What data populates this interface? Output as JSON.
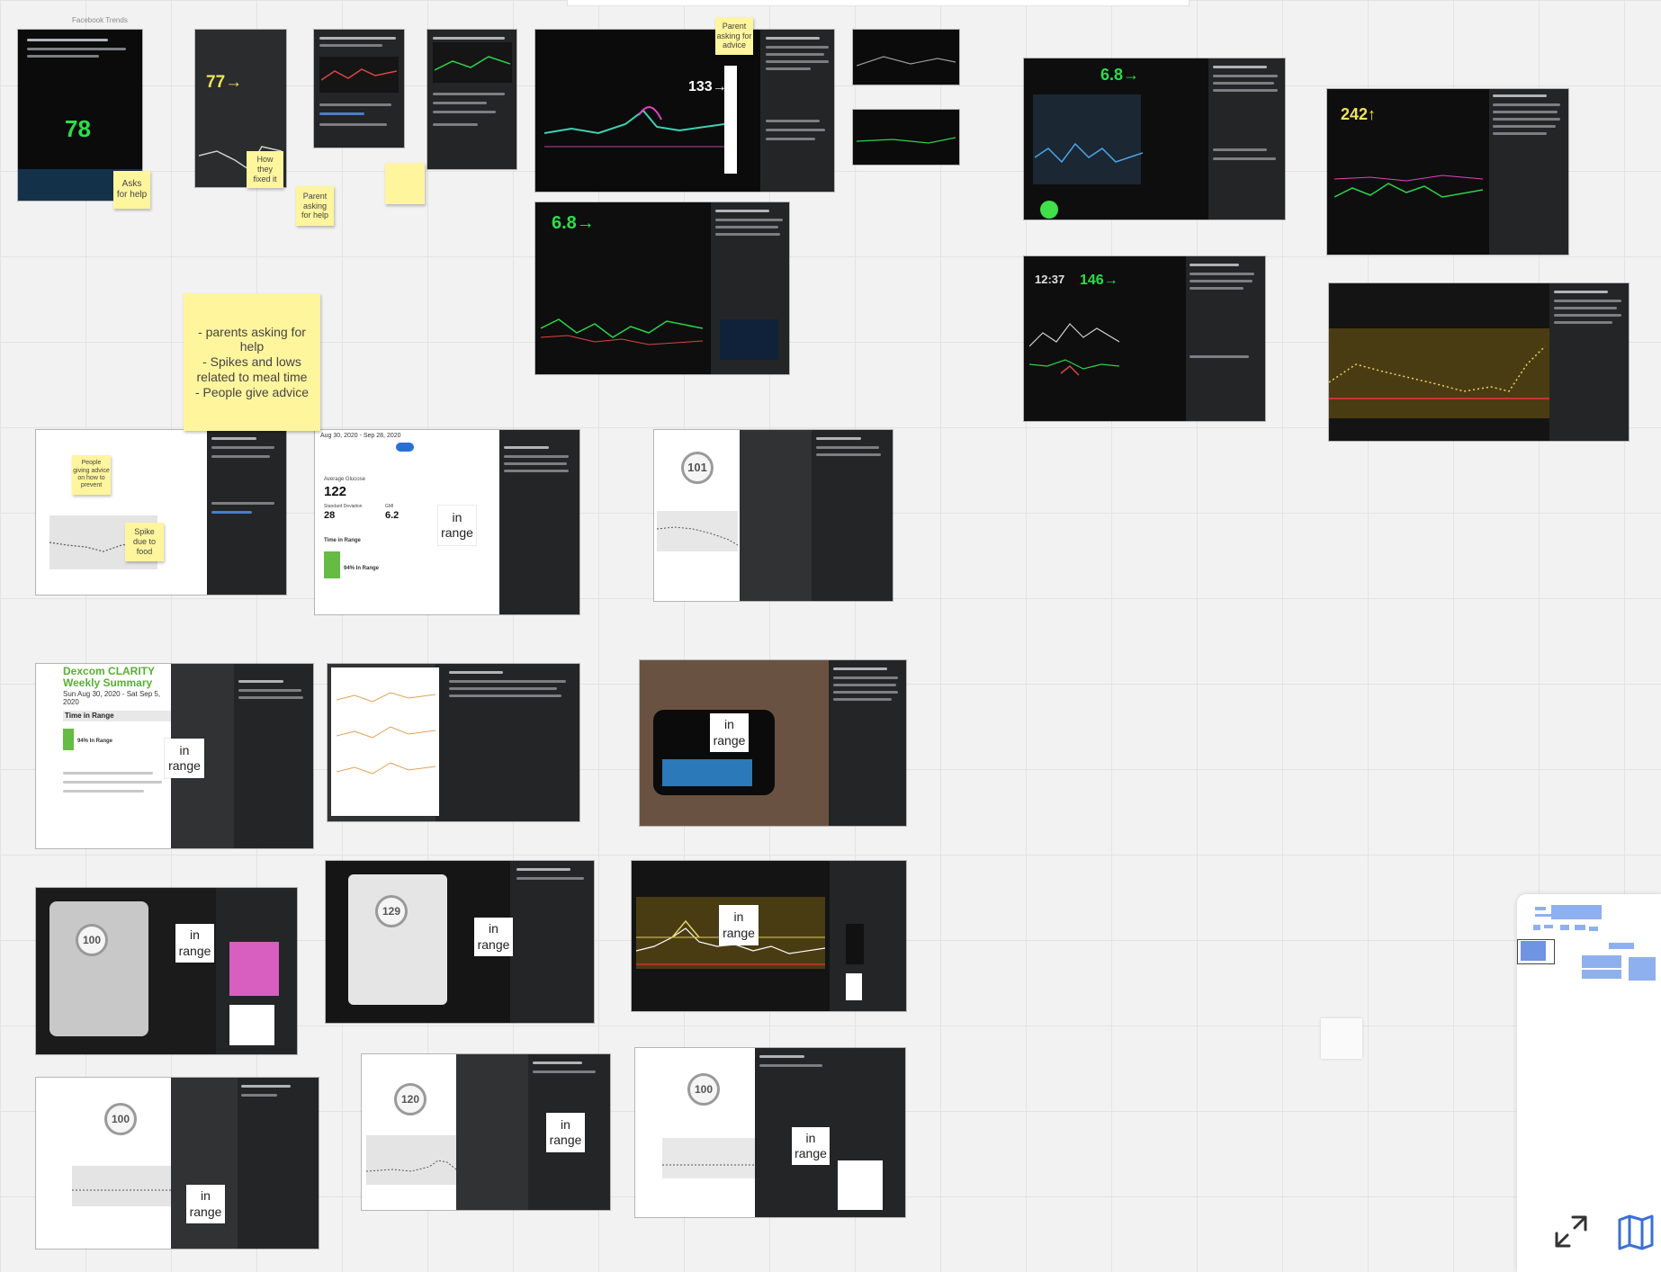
{
  "board": {
    "frame_title": "Facebook Trends"
  },
  "posts": [
    {
      "glucose": "78"
    },
    {
      "glucose": "77→"
    },
    {
      "glucose": ""
    },
    {
      "glucose": ""
    },
    {
      "glucose": "133→"
    },
    {
      "glucose": "6.8→"
    },
    {
      "glucose": "6.8→"
    },
    {
      "glucose": "146→",
      "time": "12:37"
    },
    {
      "glucose": "242↑"
    },
    {
      "summary_date": "Aug 30, 2020 - Sep 28, 2020",
      "avg_label": "Average Glucose",
      "avg": "122",
      "sd_label": "Standard Deviation",
      "sd": "28",
      "gmi_label": "GMI",
      "gmi": "6.2",
      "tir_label": "Time in Range",
      "tir": "94% In Range"
    },
    {
      "glucose": "101"
    },
    {
      "clarity_title": "Dexcom CLARITY\nWeekly Summary",
      "clarity_dates": "Sun Aug 30, 2020 - Sat Sep 5, 2020",
      "tir_label": "Time in Range",
      "tir": "94% In Range"
    },
    {
      "glucose": "100"
    },
    {
      "glucose": "129"
    },
    {
      "glucose": "100"
    },
    {
      "glucose": "120"
    },
    {
      "glucose": "100"
    }
  ],
  "stickies": {
    "asks_for_help": "Asks\nfor help",
    "how_fixed": "How\nthey\nfixed it",
    "parent_asking_help": "Parent\nasking\nfor help",
    "parent_asking_advice": "Parent\nasking for\nadvice",
    "summary": "- parents asking for\nhelp\n- Spikes and lows\nrelated to meal time\n- People give advice",
    "people_giving_advice": "People\ngiving advice\non how to\nprevent",
    "spike_food": "Spike\ndue to\nfood"
  },
  "labels": {
    "in_range": "in\nrange"
  },
  "colors": {
    "sticky": "#fff59d",
    "glucose_green": "#28e04a",
    "fb_dark": "#242526",
    "minimap_blue": "#8fb0ee"
  },
  "icons": {
    "fit_view": "expand-arrows-icon",
    "map": "map-icon"
  }
}
